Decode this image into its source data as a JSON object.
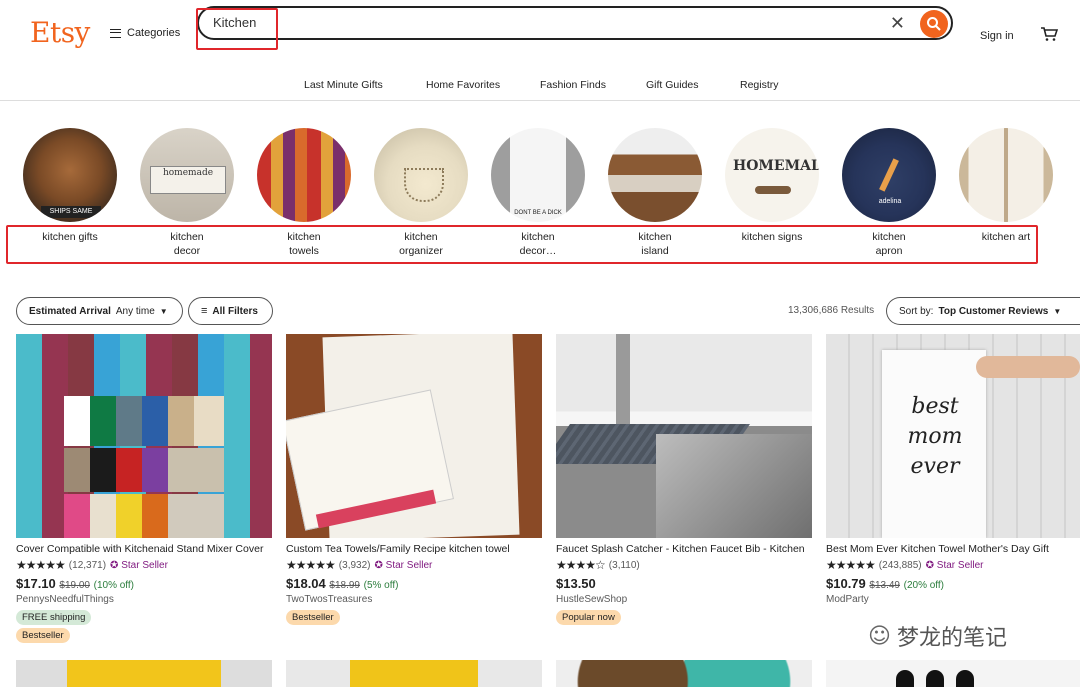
{
  "header": {
    "logo": "Etsy",
    "categories_label": "Categories",
    "search_value": "Kitchen",
    "clear_glyph": "✕",
    "signin_label": "Sign in"
  },
  "nav": [
    "Last Minute Gifts",
    "Home Favorites",
    "Fashion Finds",
    "Gift Guides",
    "Registry"
  ],
  "related": [
    {
      "line1": "kitchen gifts",
      "line2": ""
    },
    {
      "line1": "kitchen",
      "line2": "decor"
    },
    {
      "line1": "kitchen",
      "line2": "towels"
    },
    {
      "line1": "kitchen",
      "line2": "organizer"
    },
    {
      "line1": "kitchen",
      "line2": "decor…"
    },
    {
      "line1": "kitchen",
      "line2": "island"
    },
    {
      "line1": "kitchen signs",
      "line2": ""
    },
    {
      "line1": "kitchen",
      "line2": "apron"
    },
    {
      "line1": "kitchen art",
      "line2": ""
    }
  ],
  "filters": {
    "arrival_label": "Estimated Arrival",
    "arrival_value": "Any time",
    "all_filters": "All Filters",
    "results": "13,306,686 Results",
    "sort_label": "Sort by:",
    "sort_value": "Top Customer Reviews"
  },
  "listings": [
    {
      "title": "Cover Compatible with Kitchenaid Stand Mixer Cover",
      "stars": "★★★★★",
      "reviews": "(12,371)",
      "star_seller": "Star Seller",
      "price": "$17.10",
      "orig": "$19.00",
      "disc": "(10% off)",
      "shop": "PennysNeedfulThings",
      "badges": [
        "FREE shipping",
        "Bestseller"
      ]
    },
    {
      "title": "Custom Tea Towels/Family Recipe kitchen towel",
      "stars": "★★★★★",
      "reviews": "(3,932)",
      "star_seller": "Star Seller",
      "price": "$18.04",
      "orig": "$18.99",
      "disc": "(5% off)",
      "shop": "TwoTwosTreasures",
      "badges": [
        "Bestseller"
      ]
    },
    {
      "title": "Faucet Splash Catcher - Kitchen Faucet Bib - Kitchen",
      "stars": "★★★★☆",
      "reviews": "(3,110)",
      "star_seller": "",
      "price": "$13.50",
      "orig": "",
      "disc": "",
      "shop": "HustleSewShop",
      "badges": [
        "Popular now"
      ]
    },
    {
      "title": "Best Mom Ever Kitchen Towel Mother's Day Gift",
      "stars": "★★★★★",
      "reviews": "(243,885)",
      "star_seller": "Star Seller",
      "price": "$10.79",
      "orig": "$13.49",
      "disc": "(20% off)",
      "shop": "ModParty",
      "badges": []
    }
  ],
  "watermark": "梦龙的笔记",
  "colors": {
    "brand": "#f1641e",
    "annotation": "#e0262b",
    "star_seller": "#7f187f",
    "discount": "#2c7d3d"
  }
}
